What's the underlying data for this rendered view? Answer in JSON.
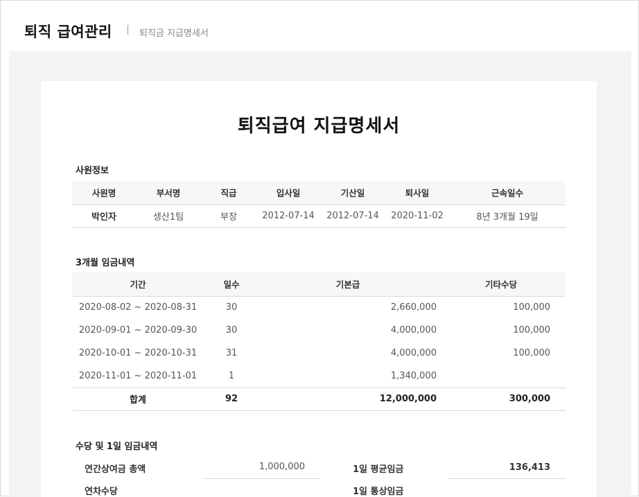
{
  "header": {
    "app_title": "퇴직 급여관리",
    "breadcrumb": "퇴직금 지급명세서"
  },
  "document": {
    "title": "퇴직급여 지급명세서"
  },
  "employee_section": {
    "title": "사원정보",
    "columns": [
      "사원명",
      "부서명",
      "직급",
      "입사일",
      "기산일",
      "퇴사일",
      "근속일수"
    ],
    "row": [
      "박인자",
      "생산1팀",
      "부장",
      "2012-07-14",
      "2012-07-14",
      "2020-11-02",
      "8년 3개월 19일"
    ]
  },
  "wage_section": {
    "title": "3개월 임금내역",
    "columns": [
      "기간",
      "일수",
      "기본급",
      "기타수당"
    ],
    "rows": [
      [
        "2020-08-02 ~ 2020-08-31",
        "30",
        "2,660,000",
        "100,000"
      ],
      [
        "2020-09-01 ~ 2020-09-30",
        "30",
        "4,000,000",
        "100,000"
      ],
      [
        "2020-10-01 ~ 2020-10-31",
        "31",
        "4,000,000",
        "100,000"
      ],
      [
        "2020-11-01 ~ 2020-11-01",
        "1",
        "1,340,000",
        ""
      ]
    ],
    "total": [
      "합계",
      "92",
      "12,000,000",
      "300,000"
    ]
  },
  "allowance_section": {
    "title": "수당 및 1일 임금내역",
    "annual_bonus_label": "연간상여금 총액",
    "annual_bonus_value": "1,000,000",
    "daily_avg_label": "1일 평균임금",
    "daily_avg_value": "136,413",
    "annual_leave_label": "연차수당",
    "daily_normal_label": "1일 통상임금"
  }
}
